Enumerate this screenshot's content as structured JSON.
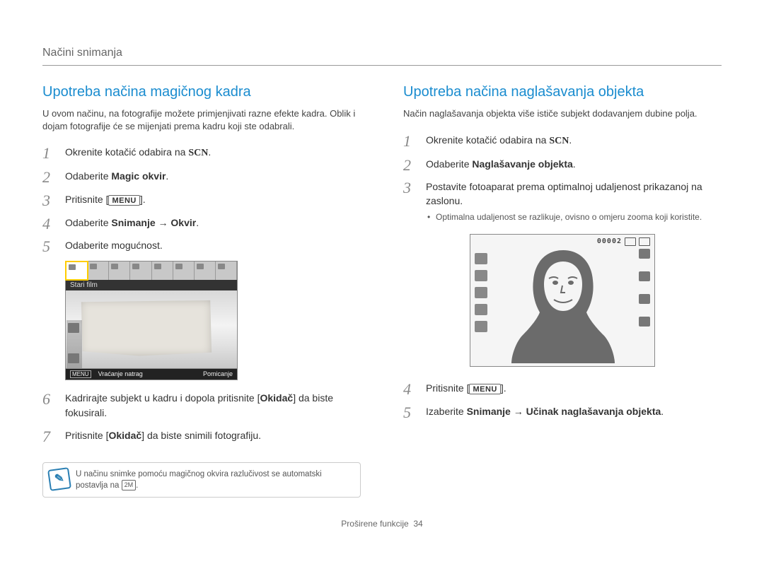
{
  "header": "Načini snimanja",
  "left": {
    "title": "Upotreba načina magičnog kadra",
    "intro": "U ovom načinu, na fotografije možete primjenjivati razne efekte kadra. Oblik i dojam fotografije će se mijenjati prema kadru koji ste odabrali.",
    "steps": {
      "s1_pre": "Okrenite kotačić odabira na ",
      "scn": "SCN",
      "s1_post": ".",
      "s2_pre": "Odaberite ",
      "s2_b": "Magic okvir",
      "s2_post": ".",
      "s3_pre": "Pritisnite [",
      "menu": "MENU",
      "s3_post": "].",
      "s4_pre": "Odaberite ",
      "s4_b1": "Snimanje",
      "s4_arrow": " → ",
      "s4_b2": "Okvir",
      "s4_post": ".",
      "s5": "Odaberite mogućnost.",
      "s6_pre": "Kadrirajte subjekt u kadru i dopola pritisnite [",
      "s6_b": "Okidač",
      "s6_post": "] da biste fokusirali.",
      "s7_pre": "Pritisnite [",
      "s7_b": "Okidač",
      "s7_post": "] da biste snimili fotografiju."
    },
    "screenshot": {
      "subtitle": "Stari film",
      "bottom_menu": "MENU",
      "bottom_back": "Vraćanje natrag",
      "bottom_move": "Pomicanje"
    },
    "note_pre": "U načinu snimke pomoću magičnog okvira razlučivost se automatski postavlja na ",
    "note_badge": "2M",
    "note_post": "."
  },
  "right": {
    "title": "Upotreba načina naglašavanja objekta",
    "intro": "Način naglašavanja objekta više ističe subjekt dodavanjem dubine polja.",
    "steps": {
      "s1_pre": "Okrenite kotačić odabira na ",
      "scn": "SCN",
      "s1_post": ".",
      "s2_pre": "Odaberite ",
      "s2_b": "Naglašavanje objekta",
      "s2_post": ".",
      "s3": "Postavite fotoaparat prema optimalnoj udaljenost prikazanoj na zaslonu.",
      "s3_sub": "Optimalna udaljenost se razlikuje, ovisno o omjeru zooma koji koristite.",
      "s4_pre": "Pritisnite [",
      "menu": "MENU",
      "s4_post": "].",
      "s5_pre": "Izaberite ",
      "s5_b1": "Snimanje",
      "s5_arrow": " → ",
      "s5_b2": "Učinak naglašavanja objekta",
      "s5_post": "."
    },
    "screenshot": {
      "counter": "00002"
    }
  },
  "footer": {
    "section": "Proširene funkcije",
    "page": "34"
  }
}
